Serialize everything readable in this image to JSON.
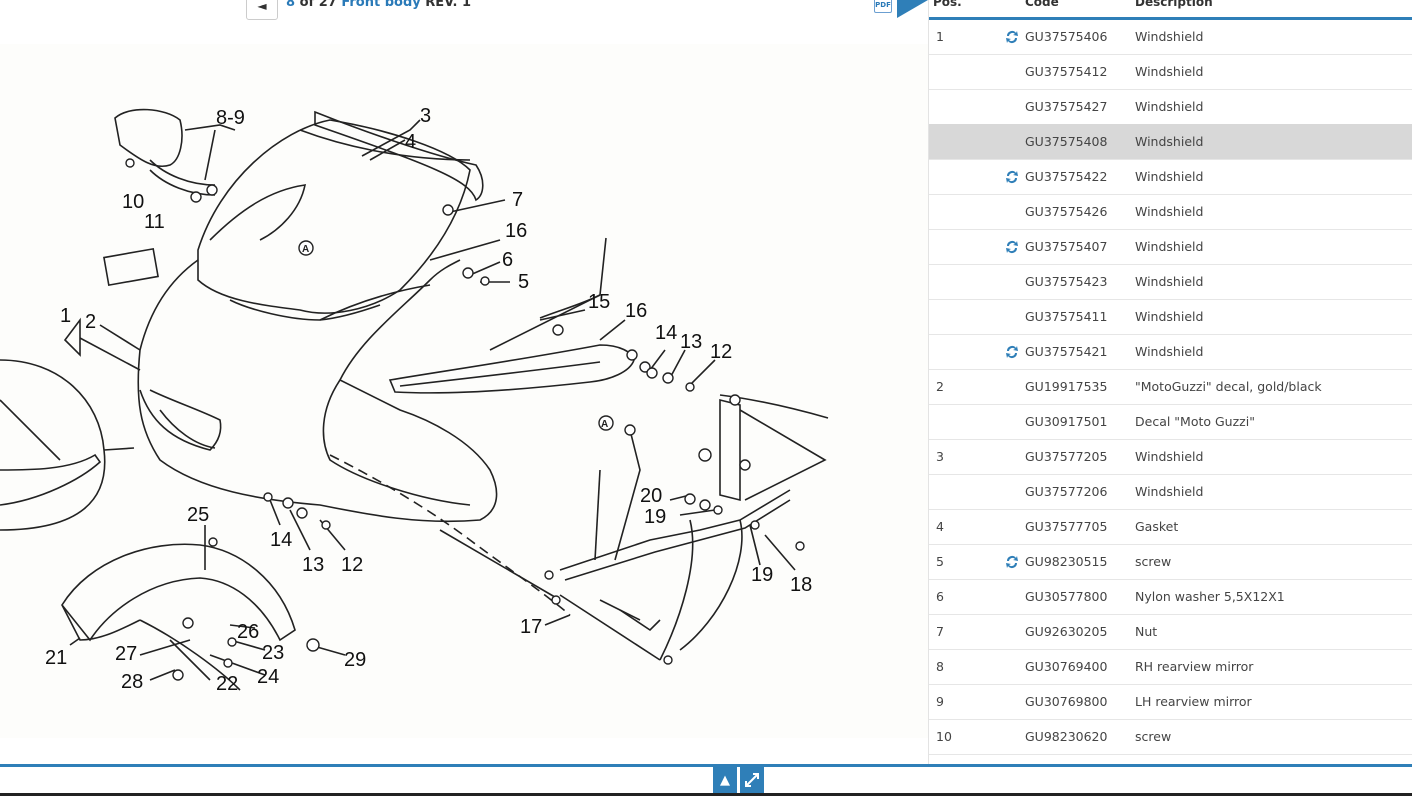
{
  "header": {
    "back_icon": "arrow-left-icon",
    "page_num": "8",
    "of_text": "of 27",
    "section": "Front body",
    "rev": "REV. 1",
    "pdf_label": "PDF"
  },
  "diagram": {
    "labels": [
      "1",
      "2",
      "3",
      "4",
      "5",
      "6",
      "7",
      "8-9",
      "10",
      "11",
      "12",
      "12",
      "12",
      "13",
      "13",
      "14",
      "14",
      "15",
      "16",
      "16",
      "17",
      "18",
      "19",
      "19",
      "20",
      "21",
      "22",
      "23",
      "24",
      "25",
      "26",
      "27",
      "28",
      "29"
    ]
  },
  "table": {
    "headers": {
      "pos": "Pos.",
      "code": "Code",
      "desc": "Description"
    },
    "rows": [
      {
        "pos": "1",
        "swap": true,
        "code": "GU37575406",
        "desc": "Windshield"
      },
      {
        "pos": "",
        "swap": false,
        "code": "GU37575412",
        "desc": "Windshield"
      },
      {
        "pos": "",
        "swap": false,
        "code": "GU37575427",
        "desc": "Windshield"
      },
      {
        "pos": "",
        "swap": false,
        "code": "GU37575408",
        "desc": "Windshield",
        "selected": true
      },
      {
        "pos": "",
        "swap": true,
        "code": "GU37575422",
        "desc": "Windshield"
      },
      {
        "pos": "",
        "swap": false,
        "code": "GU37575426",
        "desc": "Windshield"
      },
      {
        "pos": "",
        "swap": true,
        "code": "GU37575407",
        "desc": "Windshield"
      },
      {
        "pos": "",
        "swap": false,
        "code": "GU37575423",
        "desc": "Windshield"
      },
      {
        "pos": "",
        "swap": false,
        "code": "GU37575411",
        "desc": "Windshield"
      },
      {
        "pos": "",
        "swap": true,
        "code": "GU37575421",
        "desc": "Windshield"
      },
      {
        "pos": "2",
        "swap": false,
        "code": "GU19917535",
        "desc": "\"MotoGuzzi\" decal, gold/black"
      },
      {
        "pos": "",
        "swap": false,
        "code": "GU30917501",
        "desc": "Decal \"Moto Guzzi\""
      },
      {
        "pos": "3",
        "swap": false,
        "code": "GU37577205",
        "desc": "Windshield"
      },
      {
        "pos": "",
        "swap": false,
        "code": "GU37577206",
        "desc": "Windshield"
      },
      {
        "pos": "4",
        "swap": false,
        "code": "GU37577705",
        "desc": "Gasket"
      },
      {
        "pos": "5",
        "swap": true,
        "code": "GU98230515",
        "desc": "screw"
      },
      {
        "pos": "6",
        "swap": false,
        "code": "GU30577800",
        "desc": "Nylon washer 5,5X12X1"
      },
      {
        "pos": "7",
        "swap": false,
        "code": "GU92630205",
        "desc": "Nut"
      },
      {
        "pos": "8",
        "swap": false,
        "code": "GU30769400",
        "desc": "RH rearview mirror"
      },
      {
        "pos": "9",
        "swap": false,
        "code": "GU30769800",
        "desc": "LH rearview mirror"
      },
      {
        "pos": "10",
        "swap": false,
        "code": "GU98230620",
        "desc": "screw"
      }
    ]
  },
  "footer": {
    "up_icon": "caret-up-icon",
    "expand_icon": "expand-arrows-icon"
  },
  "colors": {
    "accent": "#2f7fb8",
    "selected_row": "#d8d8d8"
  }
}
